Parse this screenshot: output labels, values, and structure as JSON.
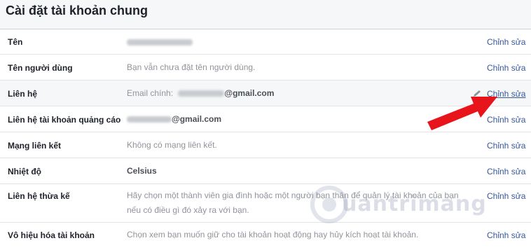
{
  "page": {
    "title": "Cài đặt tài khoản chung"
  },
  "rows": [
    {
      "label": "Tên",
      "value": "",
      "edit": "Chỉnh sửa"
    },
    {
      "label": "Tên người dùng",
      "value": "Bạn vẫn chưa đặt tên người dùng.",
      "edit": "Chỉnh sửa"
    },
    {
      "label": "Liên hệ",
      "value_prefix": "Email chính:",
      "value_suffix": "@gmail.com",
      "edit": "Chỉnh sửa"
    },
    {
      "label": "Liên hệ tài khoản quảng cáo",
      "value_suffix": "@gmail.com",
      "edit": "Chỉnh sửa"
    },
    {
      "label": "Mạng liên kết",
      "value": "Không có mạng liên kết.",
      "edit": "Chỉnh sửa"
    },
    {
      "label": "Nhiệt độ",
      "value": "Celsius",
      "edit": "Chỉnh sửa"
    },
    {
      "label": "Liên hệ thừa kế",
      "value_line1": "Hãy chọn một thành viên gia đình hoặc một người bạn thân để quản lý tài khoản của bạn",
      "value_line2": "nếu có điều gì đó xảy ra với bạn.",
      "edit": "Chỉnh sửa"
    },
    {
      "label": "Vô hiệu hóa tài khoản",
      "value": "Chọn xem bạn muốn giữ cho tài khoản hoạt động hay hủy kích hoạt tài khoản.",
      "edit": "Chỉnh sửa"
    }
  ],
  "watermark": {
    "text": "uantrimang"
  },
  "colors": {
    "link": "#365899",
    "arrow": "#e8141b",
    "header_bg": "#f6f7f9"
  },
  "icons": {
    "pencil": "pencil-icon",
    "arrow": "red-arrow-annotation"
  }
}
